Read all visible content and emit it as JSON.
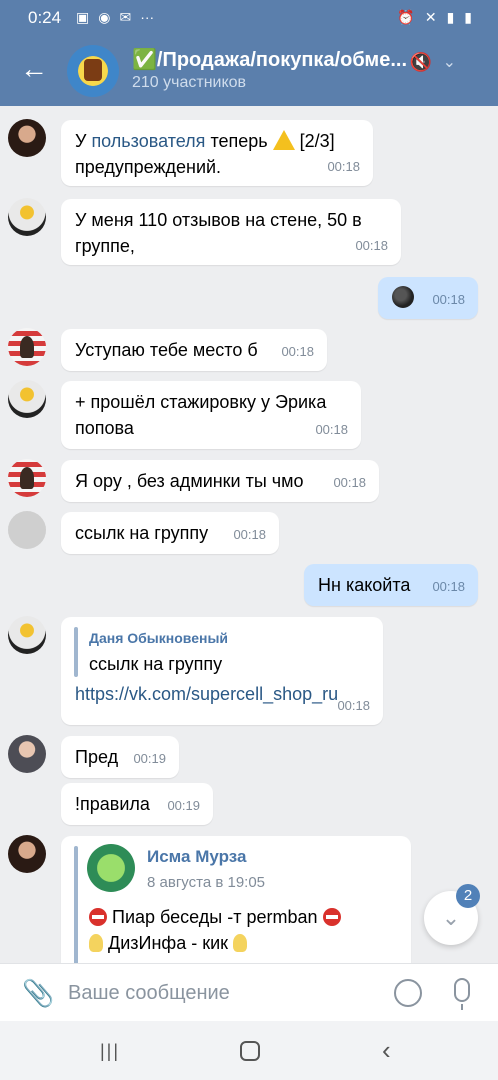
{
  "status_bar": {
    "time": "0:24"
  },
  "header": {
    "title": "✅/Продажа/покупка/обме...",
    "subtitle": "210 участников"
  },
  "messages": [
    {
      "parts": [
        "У ",
        "пользователя",
        " теперь ",
        " [2/3]"
      ],
      "line2": "предупреждений.",
      "time": "00:18"
    },
    {
      "text": "У меня 110 отзывов на стене, 50 в",
      "line2": "группе,",
      "time": "00:18"
    },
    {
      "time": "00:18"
    },
    {
      "text": "Уступаю тебе место б",
      "time": "00:18"
    },
    {
      "text": "+ прошёл стажировку у Эрика",
      "line2": "попова",
      "time": "00:18"
    },
    {
      "text": "Я ору , без админки ты чмо",
      "time": "00:18"
    },
    {
      "text": "ссылк на группу",
      "time": "00:18"
    },
    {
      "text": "Нн какойта",
      "time": "00:18"
    },
    {
      "reply_author": "Даня Обыкновеный",
      "reply_text": "ссылк на группу",
      "link": "https://vk.com/supercell_shop_ru",
      "time": "00:18"
    },
    {
      "text": "Пред",
      "time": "00:19"
    },
    {
      "text": "!правила",
      "time": "00:19"
    },
    {
      "fwd_author": "Исма Мурза",
      "fwd_date": "8 августа в 19:05",
      "line1": "Пиар беседы -т permban",
      "line2": "ДизИнфа - кик"
    }
  ],
  "unread_badge": "2",
  "input": {
    "placeholder": "Ваше сообщение"
  },
  "icons": [
    "back-arrow-icon",
    "mute-icon",
    "chevron-down-icon",
    "attach-icon",
    "emoji-icon",
    "mic-icon",
    "scroll-down-icon"
  ]
}
